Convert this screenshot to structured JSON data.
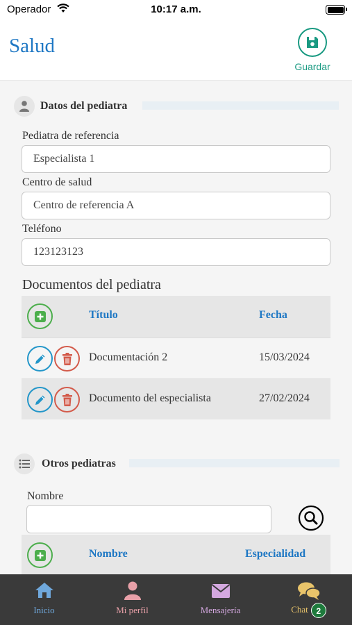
{
  "status_bar": {
    "carrier": "Operador",
    "time": "10:17 a.m."
  },
  "header": {
    "title": "Salud",
    "save_label": "Guardar"
  },
  "pediatra_section": {
    "title": "Datos del pediatra",
    "fields": [
      {
        "label": "Pediatra de referencia",
        "value": "Especialista 1"
      },
      {
        "label": "Centro de salud",
        "value": "Centro de referencia A"
      },
      {
        "label": "Teléfono",
        "value": "123123123"
      }
    ]
  },
  "documents": {
    "title": "Documentos del pediatra",
    "columns": {
      "title": "Título",
      "date": "Fecha"
    },
    "rows": [
      {
        "title": "Documentación 2",
        "date": "15/03/2024"
      },
      {
        "title": "Documento del especialista",
        "date": "27/02/2024"
      }
    ]
  },
  "otros_section": {
    "title": "Otros pediatras",
    "search_label": "Nombre",
    "search_value": "",
    "columns": {
      "name": "Nombre",
      "specialty": "Especialidad"
    }
  },
  "tabbar": {
    "items": [
      {
        "label": "Inicio",
        "icon": "home-icon",
        "color": "#6fa8dc"
      },
      {
        "label": "Mi perfil",
        "icon": "user-icon",
        "color": "#e8a0a8"
      },
      {
        "label": "Mensajería",
        "icon": "envelope-icon",
        "color": "#d4a8e0"
      },
      {
        "label": "Chat",
        "icon": "chat-icon",
        "color": "#e9c46a",
        "badge": "2"
      }
    ]
  },
  "colors": {
    "accent": "#1f78c4",
    "save": "#1a9a82",
    "add": "#4cae4c",
    "edit": "#2396c9",
    "delete": "#d35a4a"
  }
}
